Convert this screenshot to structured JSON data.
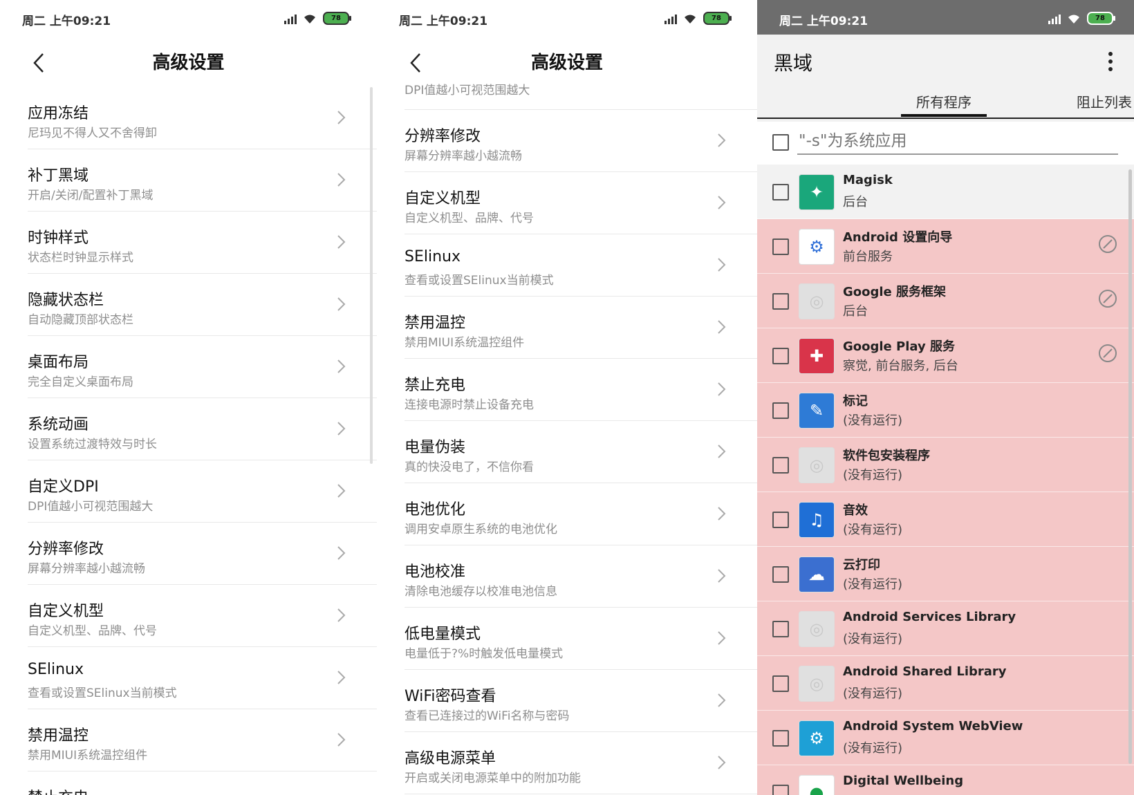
{
  "status": {
    "time": "周二 上午09:21",
    "battery": "78"
  },
  "panel1": {
    "title": "高级设置",
    "items": [
      {
        "title": "应用冻结",
        "sub": "尼玛见不得人又不舍得卸"
      },
      {
        "title": "补丁黑域",
        "sub": "开启/关闭/配置补丁黑域"
      },
      {
        "title": "时钟样式",
        "sub": "状态栏时钟显示样式"
      },
      {
        "title": "隐藏状态栏",
        "sub": "自动隐藏顶部状态栏"
      },
      {
        "title": "桌面布局",
        "sub": "完全自定义桌面布局"
      },
      {
        "title": "系统动画",
        "sub": "设置系统过渡特效与时长"
      },
      {
        "title": "自定义DPI",
        "sub": "DPI值越小可视范围越大"
      },
      {
        "title": "分辨率修改",
        "sub": "屏幕分辨率越小越流畅"
      },
      {
        "title": "自定义机型",
        "sub": "自定义机型、品牌、代号"
      },
      {
        "title": "SElinux",
        "sub": "查看或设置SElinux当前模式"
      },
      {
        "title": "禁用温控",
        "sub": "禁用MIUI系统温控组件"
      },
      {
        "title": "禁止充电",
        "sub": ""
      }
    ]
  },
  "panel2": {
    "title": "高级设置",
    "partial_top": "DPI值越小可视范围越大",
    "items": [
      {
        "title": "分辨率修改",
        "sub": "屏幕分辨率越小越流畅"
      },
      {
        "title": "自定义机型",
        "sub": "自定义机型、品牌、代号"
      },
      {
        "title": "SElinux",
        "sub": "查看或设置SElinux当前模式"
      },
      {
        "title": "禁用温控",
        "sub": "禁用MIUI系统温控组件"
      },
      {
        "title": "禁止充电",
        "sub": "连接电源时禁止设备充电"
      },
      {
        "title": "电量伪装",
        "sub": "真的快没电了，不信你看"
      },
      {
        "title": "电池优化",
        "sub": "调用安卓原生系统的电池优化"
      },
      {
        "title": "电池校准",
        "sub": "清除电池缓存以校准电池信息"
      },
      {
        "title": "低电量模式",
        "sub": "电量低于?%时触发低电量模式"
      },
      {
        "title": "WiFi密码查看",
        "sub": "查看已连接过的WiFi名称与密码"
      },
      {
        "title": "高级电源菜单",
        "sub": "开启或关闭电源菜单中的附加功能"
      }
    ]
  },
  "panel3": {
    "title": "黑域",
    "tabs": [
      "所有程序",
      "阻止列表"
    ],
    "filter_placeholder": "\"-s\"为系统应用",
    "apps": [
      {
        "name": "Magisk",
        "state": "后台",
        "blocked": false,
        "icon": "magisk-icon",
        "color": "#1aa77b",
        "glyph": "✦"
      },
      {
        "name": "Android 设置向导",
        "state": "前台服务",
        "blocked": true,
        "icon": "gear-icon",
        "color": "#ffffff",
        "glyph": "⚙"
      },
      {
        "name": "Google 服务框架",
        "state": "后台",
        "blocked": true,
        "icon": "default-app-icon",
        "color": "#e0e0e0",
        "glyph": "◎"
      },
      {
        "name": "Google Play 服务",
        "state": "察觉, 前台服务, 后台",
        "blocked": true,
        "icon": "puzzle-icon",
        "color": "#d9344a",
        "glyph": "✚"
      },
      {
        "name": "标记",
        "state": "(没有运行)",
        "blocked": true,
        "icon": "pen-icon",
        "color": "#2e7bd6",
        "glyph": "✎"
      },
      {
        "name": "软件包安装程序",
        "state": "(没有运行)",
        "blocked": true,
        "icon": "default-app-icon",
        "color": "#e0e0e0",
        "glyph": "◎"
      },
      {
        "name": "音效",
        "state": "(没有运行)",
        "blocked": true,
        "icon": "sound-wave-icon",
        "color": "#1f6fd6",
        "glyph": "♫"
      },
      {
        "name": "云打印",
        "state": "(没有运行)",
        "blocked": true,
        "icon": "cloud-print-icon",
        "color": "#3b6fd0",
        "glyph": "☁"
      },
      {
        "name": "Android Services Library",
        "state": "(没有运行)",
        "blocked": true,
        "icon": "default-app-icon",
        "color": "#e0e0e0",
        "glyph": "◎"
      },
      {
        "name": "Android Shared Library",
        "state": "(没有运行)",
        "blocked": true,
        "icon": "default-app-icon",
        "color": "#e0e0e0",
        "glyph": "◎"
      },
      {
        "name": "Android System WebView",
        "state": "(没有运行)",
        "blocked": true,
        "icon": "webview-gear-icon",
        "color": "#1ea0d6",
        "glyph": "⚙"
      },
      {
        "name": "Digital Wellbeing",
        "state": "",
        "blocked": true,
        "icon": "wellbeing-icon",
        "color": "#ffffff",
        "glyph": "●"
      }
    ]
  }
}
